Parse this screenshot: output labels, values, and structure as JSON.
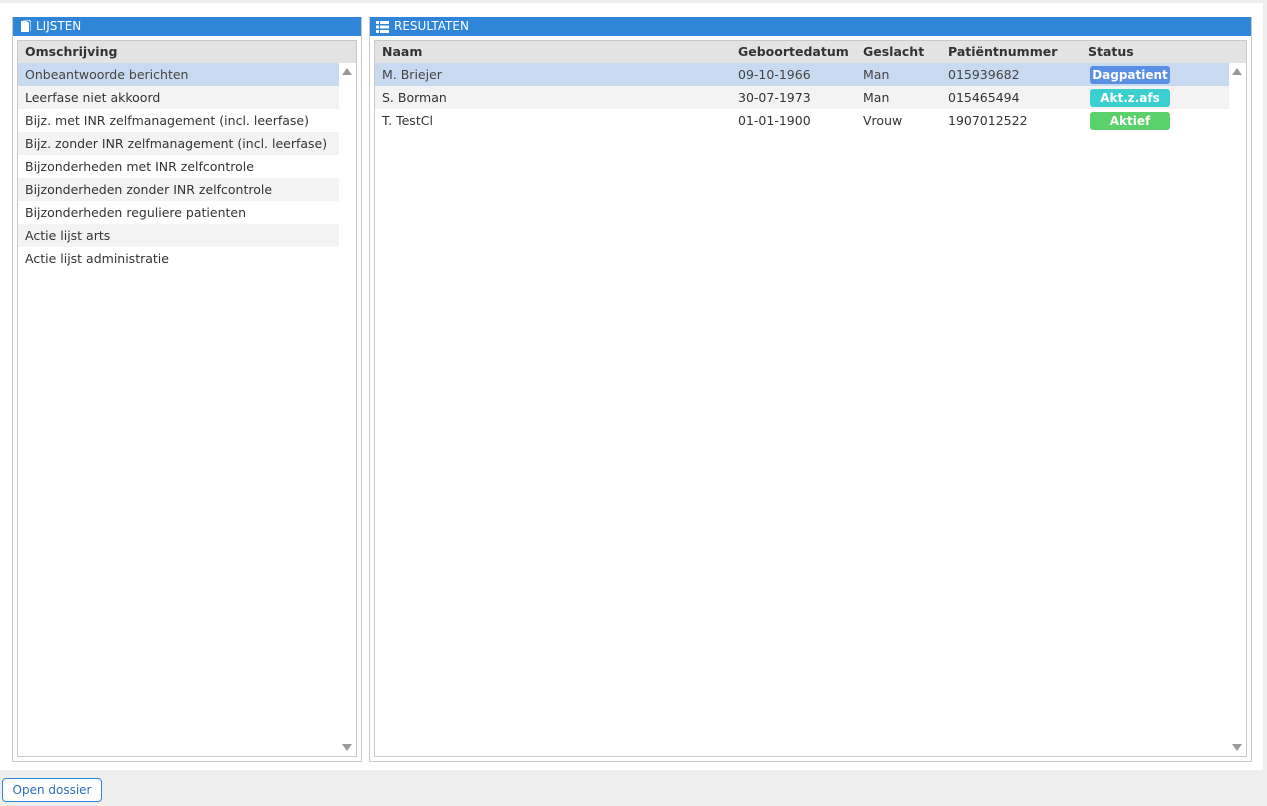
{
  "left_panel": {
    "title": "LIJSTEN",
    "column_header": "Omschrijving",
    "items": [
      "Onbeantwoorde berichten",
      "Leerfase niet akkoord",
      "Bijz. met INR zelfmanagement (incl. leerfase)",
      "Bijz. zonder INR zelfmanagement (incl. leerfase)",
      "Bijzonderheden met INR zelfcontrole",
      "Bijzonderheden zonder INR zelfcontrole",
      "Bijzonderheden reguliere patienten",
      "Actie lijst arts",
      "Actie lijst administratie"
    ],
    "selected_index": 0
  },
  "right_panel": {
    "title": "RESULTATEN",
    "columns": {
      "naam": "Naam",
      "geboortedatum": "Geboortedatum",
      "geslacht": "Geslacht",
      "patientnummer": "Patiëntnummer",
      "status": "Status"
    },
    "rows": [
      {
        "naam": "M. Briejer",
        "geboortedatum": "09-10-1966",
        "geslacht": "Man",
        "patientnummer": "015939682",
        "status": "Dagpatient",
        "status_color": "#5b8fe6"
      },
      {
        "naam": "S. Borman",
        "geboortedatum": "30-07-1973",
        "geslacht": "Man",
        "patientnummer": "015465494",
        "status": "Akt.z.afs",
        "status_color": "#3ccfcf"
      },
      {
        "naam": "T. TestCl",
        "geboortedatum": "01-01-1900",
        "geslacht": "Vrouw",
        "patientnummer": "1907012522",
        "status": "Aktief",
        "status_color": "#5ad16a"
      }
    ],
    "selected_index": 0
  },
  "footer": {
    "open_button_label": "Open dossier"
  },
  "colors": {
    "header_blue": "#2f86d8",
    "selected_row": "#c8daf0"
  },
  "icons": {
    "lijsten": "document-icon",
    "resultaten": "list-icon"
  }
}
